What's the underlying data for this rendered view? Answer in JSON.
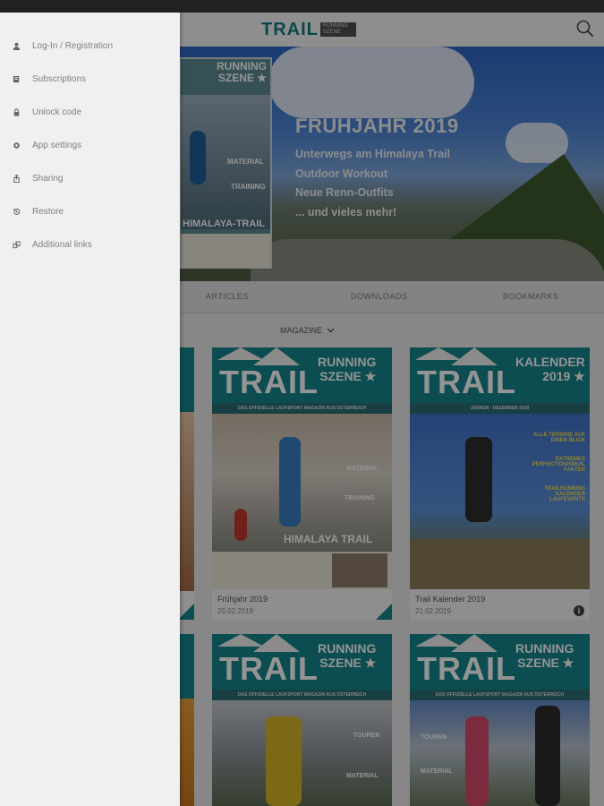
{
  "app": {
    "logo_text": "TRAIL",
    "logo_box_lines": [
      "RUNNING",
      "SZENE"
    ]
  },
  "hero": {
    "title": "FRÜHJAHR 2019",
    "lines": [
      "Unterwegs am Himalaya Trail",
      "Outdoor Workout",
      "Neue Renn-Outfits",
      "... und vieles mehr!"
    ],
    "cover": {
      "title_lines": [
        "RUNNING",
        "SZENE ★"
      ],
      "section_materials": "MATERIAL",
      "section_training": "TRAINING",
      "name": "HIMALAYA-TRAIL"
    }
  },
  "tabs": [
    {
      "label": "ARTICLES"
    },
    {
      "label": "DOWNLOADS"
    },
    {
      "label": "BOOKMARKS"
    }
  ],
  "filter": {
    "label": "MAGAZINE",
    "icon": "chevron-down-icon"
  },
  "magazines": [
    {
      "cover_trail": "TRAIL",
      "cover_sub_lines": [
        "RUNNING",
        "SZENE ★"
      ],
      "cover_tag": "DAS OFFIZIELLE LAUFSPORT MAGAZIN AUS ÖSTERREICH",
      "cover_headline": "HIMALAYA TRAIL",
      "cover_sections": [
        "MATERIAL",
        "TRAINING"
      ],
      "title": "Frühjahr 2019",
      "date": "25.02.2019"
    },
    {
      "cover_trail": "TRAIL",
      "cover_sub_lines": [
        "KALENDER",
        "2019 ★"
      ],
      "cover_tag": "JÄNNER - DEZEMBER 2019",
      "cover_lines": [
        "ALLE TERMINE AUF EINEN BLICK",
        "EXTREMES PERFEKTIONISMUS, FAKTEN",
        "TRAILRUNNING KALENDER LAUFEVENTS"
      ],
      "title": "Trail Kalender 2019",
      "date": "21.02.2019",
      "info_icon": "info-icon"
    },
    {
      "cover_trail": "TRAIL",
      "cover_sub_lines": [
        "RUNNING",
        "SZENE ★"
      ],
      "cover_tag": "DAS OFFIZIELLE LAUFSPORT MAGAZIN AUS ÖSTERREICH",
      "cover_sections": [
        "TOUREN",
        "MATERIAL"
      ]
    },
    {
      "cover_trail": "TRAIL",
      "cover_sub_lines": [
        "RUNNING",
        "SZENE ★"
      ],
      "cover_tag": "DAS OFFIZIELLE LAUFSPORT MAGAZIN AUS ÖSTERREICH",
      "cover_sections": [
        "TOUREN",
        "MATERIAL"
      ]
    }
  ],
  "drawer": {
    "items": [
      {
        "label": "Log-In / Registration",
        "icon": "person-icon"
      },
      {
        "label": "Subscriptions",
        "icon": "book-icon"
      },
      {
        "label": "Unlock code",
        "icon": "lock-icon"
      },
      {
        "label": "App settings",
        "icon": "gear-icon"
      },
      {
        "label": "Sharing",
        "icon": "share-icon"
      },
      {
        "label": "Restore",
        "icon": "restore-icon"
      },
      {
        "label": "Additional links",
        "icon": "link-icon"
      }
    ]
  },
  "colors": {
    "brand": "#14858a",
    "drawer_bg": "#f0f0f0",
    "drawer_text": "#808080"
  }
}
